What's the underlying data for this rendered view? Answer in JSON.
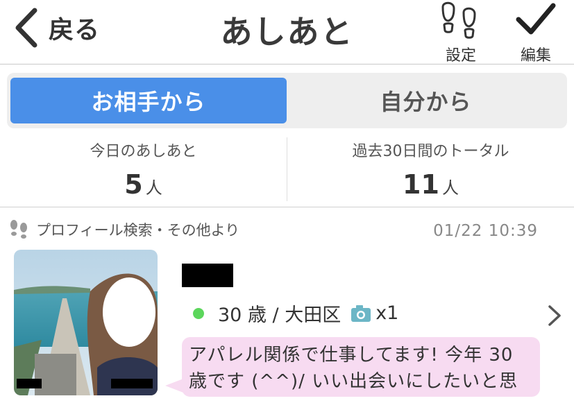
{
  "header": {
    "back_label": "戻る",
    "title": "あしあと",
    "settings_label": "設定",
    "settings_icon": "footprints-icon",
    "edit_label": "編集",
    "edit_icon": "checkmark-icon"
  },
  "tabs": [
    {
      "label": "お相手から",
      "active": true
    },
    {
      "label": "自分から",
      "active": false
    }
  ],
  "stats": {
    "today_label": "今日のあしあと",
    "today_value": "5",
    "today_unit": "人",
    "total_label": "過去30日間のトータル",
    "total_value": "11",
    "total_unit": "人"
  },
  "item": {
    "source": "プロフィール検索・その他より",
    "time": "01/22 10:39",
    "profile": "30 歳 / 大田区",
    "photo_count": "x1",
    "message": "アパレル関係で仕事してます! 今年 30 歳です (^^)/ いい出会いにしたいと思"
  },
  "colors": {
    "accent": "#4a8fe8",
    "online": "#5cd65c",
    "bubble": "#f7dbf1"
  }
}
